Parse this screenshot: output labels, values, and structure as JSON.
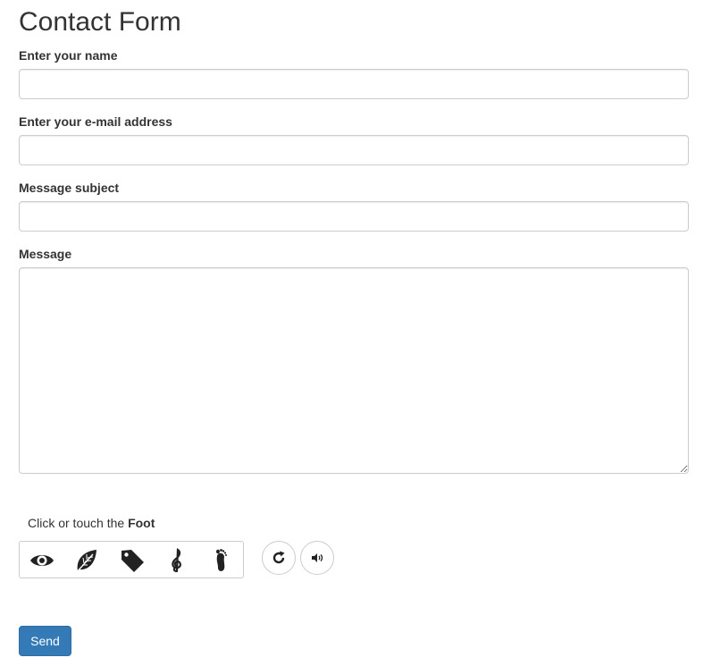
{
  "form": {
    "title": "Contact Form",
    "fields": {
      "name": {
        "label": "Enter your name",
        "value": ""
      },
      "email": {
        "label": "Enter your e-mail address",
        "value": ""
      },
      "subject": {
        "label": "Message subject",
        "value": ""
      },
      "message": {
        "label": "Message",
        "value": ""
      }
    }
  },
  "captcha": {
    "prompt_prefix": "Click or touch the",
    "target": "Foot",
    "icons": [
      "eye-icon",
      "leaf-icon",
      "tag-icon",
      "treble-clef-icon",
      "foot-icon"
    ],
    "refresh_icon": "refresh-icon",
    "audio_icon": "audio-icon"
  },
  "actions": {
    "send_label": "Send"
  },
  "colors": {
    "primary": "#337ab7",
    "text": "#333333",
    "border": "#cccccc"
  }
}
